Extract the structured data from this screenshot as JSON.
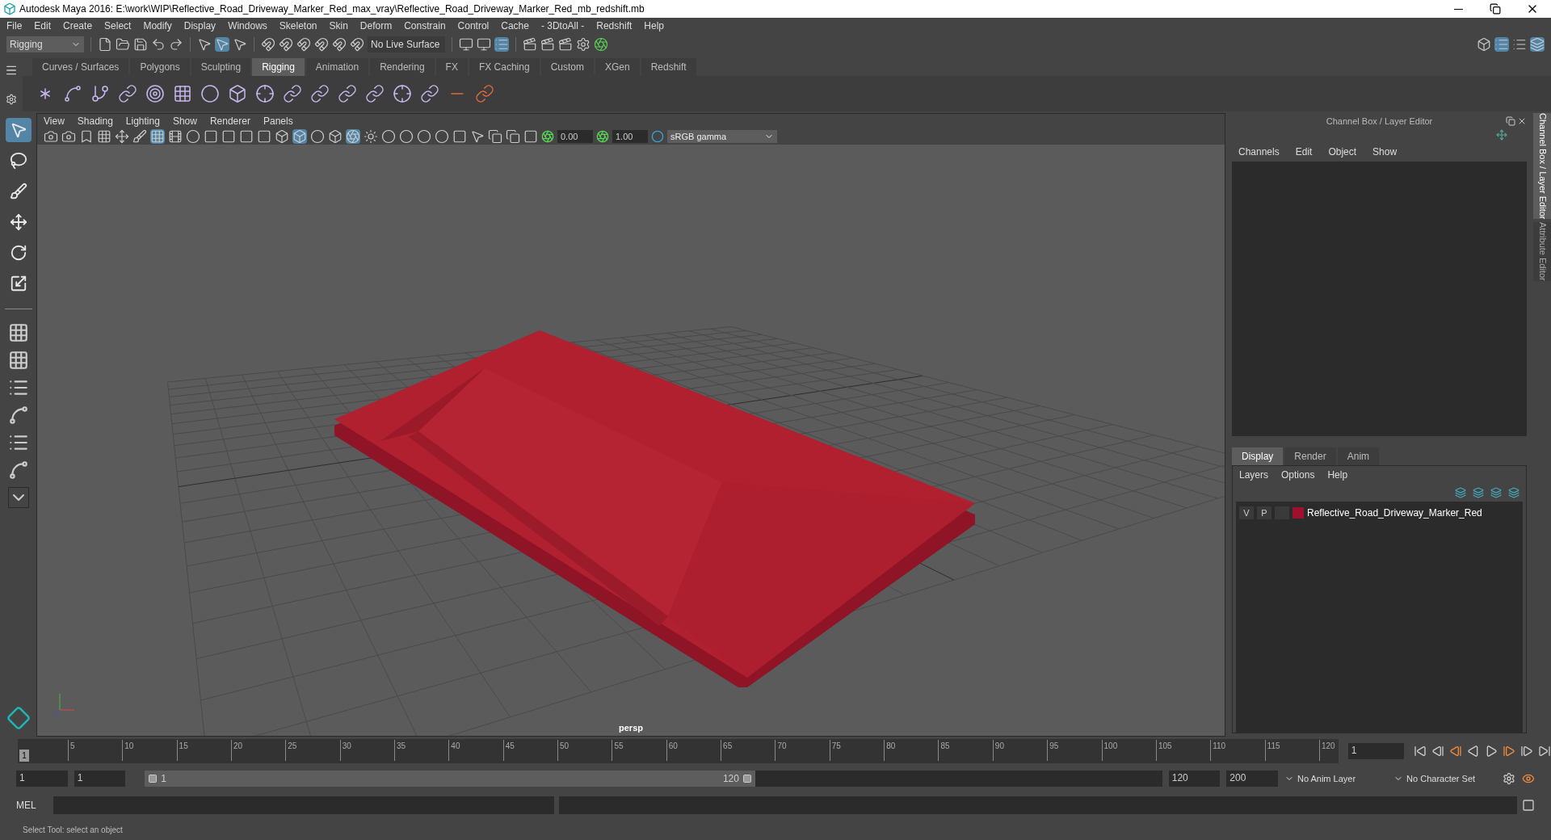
{
  "window": {
    "title": "Autodesk Maya 2016: E:\\work\\WIP\\Reflective_Road_Driveway_Marker_Red_max_vray\\Reflective_Road_Driveway_Marker_Red_mb_redshift.mb"
  },
  "menu": [
    "File",
    "Edit",
    "Create",
    "Select",
    "Modify",
    "Display",
    "Windows",
    "Skeleton",
    "Skin",
    "Deform",
    "Constrain",
    "Control",
    "Cache",
    "- 3DtoAll -",
    "Redshift",
    "Help"
  ],
  "toolbar": {
    "mode": "Rigging",
    "live_surface": "No Live Surface"
  },
  "shelf_tabs": [
    {
      "label": "Curves / Surfaces",
      "selected": false
    },
    {
      "label": "Polygons",
      "selected": false
    },
    {
      "label": "Sculpting",
      "selected": false
    },
    {
      "label": "Rigging",
      "selected": true
    },
    {
      "label": "Animation",
      "selected": false
    },
    {
      "label": "Rendering",
      "selected": false
    },
    {
      "label": "FX",
      "selected": false
    },
    {
      "label": "FX Caching",
      "selected": false
    },
    {
      "label": "Custom",
      "selected": false
    },
    {
      "label": "XGen",
      "selected": false
    },
    {
      "label": "Redshift",
      "selected": false
    }
  ],
  "tools": [
    {
      "kind": "select",
      "selected": true
    },
    {
      "kind": "lasso",
      "selected": false
    },
    {
      "kind": "paint",
      "selected": false
    },
    {
      "kind": "move",
      "selected": false
    },
    {
      "kind": "rotate",
      "selected": false
    },
    {
      "kind": "scale",
      "selected": false
    }
  ],
  "viewport": {
    "menu": [
      "View",
      "Shading",
      "Lighting",
      "Show",
      "Renderer",
      "Panels"
    ],
    "exposure": "0.00",
    "gamma": "1.00",
    "color_space": "sRGB gamma",
    "camera": "persp"
  },
  "channel_box": {
    "title": "Channel Box / Layer Editor",
    "menu": [
      "Channels",
      "Edit",
      "Object",
      "Show"
    ],
    "layer_tabs": [
      {
        "label": "Display",
        "selected": true
      },
      {
        "label": "Render",
        "selected": false
      },
      {
        "label": "Anim",
        "selected": false
      }
    ],
    "layer_menu": [
      "Layers",
      "Options",
      "Help"
    ],
    "layers": [
      {
        "visible": "V",
        "playback": "P",
        "color": "#a0102e",
        "name": "Reflective_Road_Driveway_Marker_Red"
      }
    ]
  },
  "side_tabs": [
    {
      "label": "Channel Box / Layer Editor",
      "selected": true
    },
    {
      "label": "Attribute Editor",
      "selected": false
    }
  ],
  "timeline": {
    "ticks": [
      "5",
      "10",
      "15",
      "20",
      "25",
      "30",
      "35",
      "40",
      "45",
      "50",
      "55",
      "60",
      "65",
      "70",
      "75",
      "80",
      "85",
      "90",
      "95",
      "100",
      "105",
      "110",
      "115",
      "120"
    ],
    "current_frame": "1",
    "level": 0,
    "frame_field": "1"
  },
  "range": {
    "start": "1",
    "playback_start": "1",
    "slider_start": "1",
    "slider_end": "120",
    "level": 0.6,
    "playback_end": "120",
    "end": "200",
    "anim_layer": "No Anim Layer",
    "character_set": "No Character Set"
  },
  "command_line": {
    "label": "MEL"
  },
  "status": "Select Tool: select an object"
}
